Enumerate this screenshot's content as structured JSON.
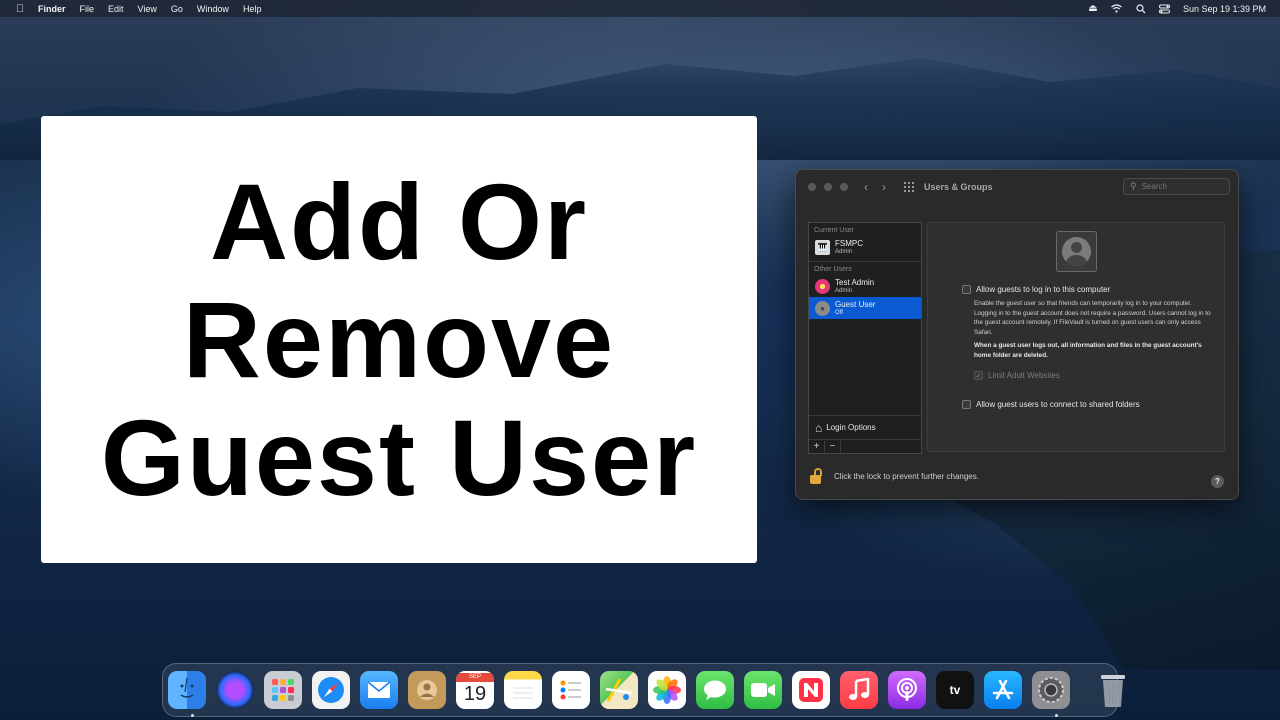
{
  "menubar": {
    "app": "Finder",
    "menus": [
      "File",
      "Edit",
      "View",
      "Go",
      "Window",
      "Help"
    ],
    "clock": "Sun Sep 19  1:39 PM"
  },
  "title_card": {
    "lines": [
      "Add Or",
      "Remove",
      "Guest User"
    ]
  },
  "window": {
    "title": "Users & Groups",
    "search_placeholder": "Search",
    "current_user_label": "Current User",
    "other_users_label": "Other Users",
    "users": [
      {
        "name": "FSMPC",
        "role": "Admin"
      },
      {
        "name": "Test Admin",
        "role": "Admin"
      },
      {
        "name": "Guest User",
        "role": "Off"
      }
    ],
    "login_options": "Login Options",
    "add_symbol": "+",
    "remove_symbol": "−",
    "allow_guests_label": "Allow guests to log in to this computer",
    "guest_description": "Enable the guest user so that friends can temporarily log in to your computer. Logging in to the guest account does not require a password. Users cannot log in to the guest account remotely. If FileVault is turned on guest users can only access Safari.",
    "guest_warning": "When a guest user logs out, all information and files in the guest account's home folder are deleted.",
    "limit_adult_label": "Limit Adult Websites",
    "shared_folders_label": "Allow guest users to connect to shared folders",
    "lock_text": "Click the lock to prevent further changes.",
    "help_symbol": "?"
  },
  "dock": {
    "calendar_month": "SEP",
    "calendar_day": "19",
    "tv_label": "tv",
    "apps": [
      "Finder",
      "Siri",
      "Launchpad",
      "Safari",
      "Mail",
      "Contacts",
      "Calendar",
      "Notes",
      "Reminders",
      "Maps",
      "Photos",
      "Messages",
      "FaceTime",
      "News",
      "Music",
      "Podcasts",
      "TV",
      "App Store",
      "System Preferences",
      "Trash"
    ]
  },
  "colors": {
    "selection": "#0a5bd1",
    "window_bg": "#2a2a2b",
    "lock": "#e3a93d"
  }
}
